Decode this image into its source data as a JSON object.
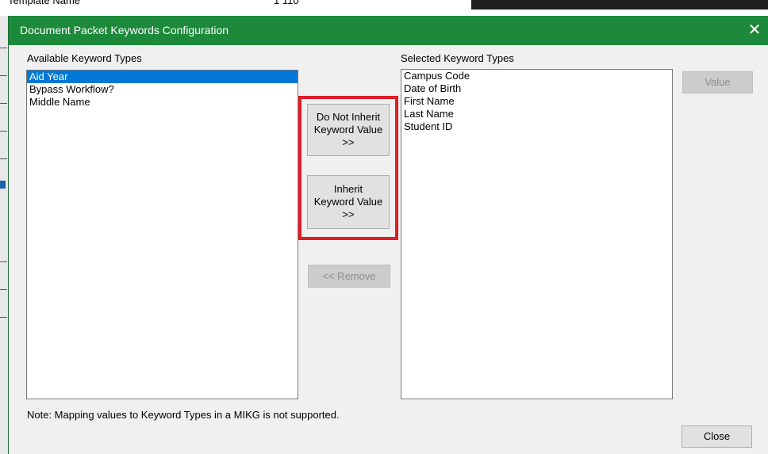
{
  "background": {
    "field_label": "Template Name",
    "field_value": "1 110"
  },
  "dialog": {
    "title": "Document Packet Keywords Configuration",
    "close_glyph": "✕"
  },
  "available": {
    "label": "Available Keyword Types",
    "items": [
      "Aid Year",
      "Bypass Workflow?",
      "Middle Name"
    ],
    "selected_index": 0
  },
  "selected": {
    "label": "Selected Keyword Types",
    "items": [
      "Campus Code",
      "Date of Birth",
      "First Name",
      "Last Name",
      "Student ID"
    ]
  },
  "buttons": {
    "do_not_inherit_line1": "Do Not Inherit",
    "do_not_inherit_line2": "Keyword Value",
    "do_not_inherit_line3": ">>",
    "inherit_line1": "Inherit",
    "inherit_line2": "Keyword Value",
    "inherit_line3": ">>",
    "remove": "<< Remove",
    "value": "Value",
    "close": "Close"
  },
  "note": "Note: Mapping values to Keyword Types in a MIKG is not supported.",
  "colors": {
    "titlebar": "#1c8a3a",
    "selection": "#0078d7",
    "highlight": "#e01c26"
  }
}
